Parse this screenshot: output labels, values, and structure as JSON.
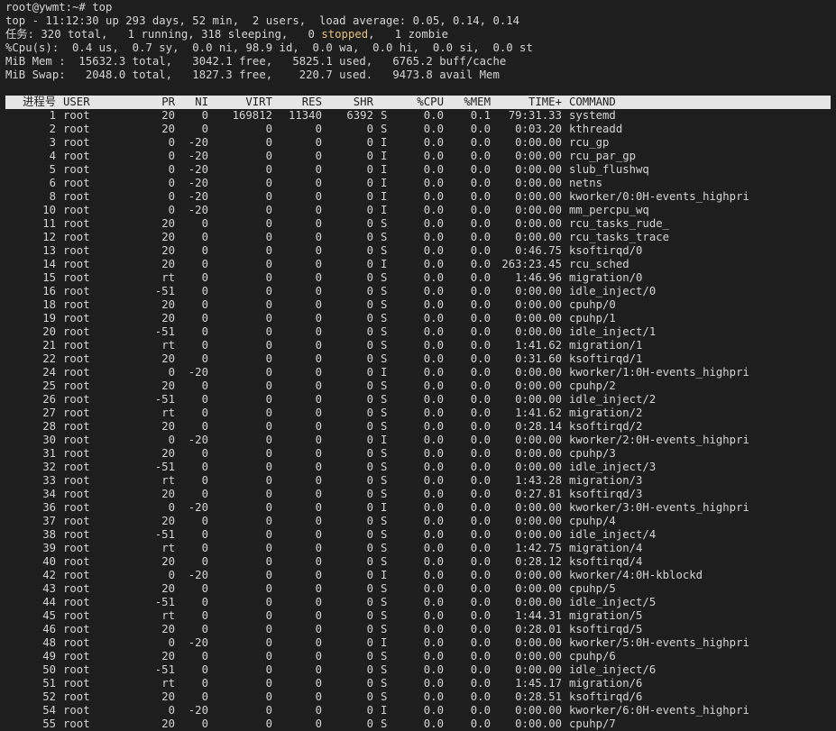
{
  "prompt_line": "root@ywmt:~# top",
  "summary": {
    "uptime_line": "top - 11:12:30 up 293 days, 52 min,  2 users,  load average: 0.05, 0.14, 0.14",
    "tasks_before": "任务: 320 total,   1 running, 318 sleeping,   0 ",
    "tasks_stopped": "stopped",
    "tasks_after": ",   1 zombie",
    "cpu_line": "%Cpu(s):  0.4 us,  0.7 sy,  0.0 ni, 98.9 id,  0.0 wa,  0.0 hi,  0.0 si,  0.0 st",
    "mem_line": "MiB Mem :  15632.3 total,   3042.1 free,   5825.1 used,   6765.2 buff/cache",
    "swap_line": "MiB Swap:   2048.0 total,   1827.3 free,    220.7 used.   9473.8 avail Mem"
  },
  "columns": [
    "进程号",
    "USER",
    "PR",
    "NI",
    "VIRT",
    "RES",
    "SHR",
    "",
    "%CPU",
    "%MEM",
    "TIME+",
    "COMMAND"
  ],
  "processes": [
    [
      "1",
      "root",
      "20",
      "0",
      "169812",
      "11340",
      "6392",
      "S",
      "0.0",
      "0.1",
      "79:31.33",
      "systemd"
    ],
    [
      "2",
      "root",
      "20",
      "0",
      "0",
      "0",
      "0",
      "S",
      "0.0",
      "0.0",
      "0:03.20",
      "kthreadd"
    ],
    [
      "3",
      "root",
      "0",
      "-20",
      "0",
      "0",
      "0",
      "I",
      "0.0",
      "0.0",
      "0:00.00",
      "rcu_gp"
    ],
    [
      "4",
      "root",
      "0",
      "-20",
      "0",
      "0",
      "0",
      "I",
      "0.0",
      "0.0",
      "0:00.00",
      "rcu_par_gp"
    ],
    [
      "5",
      "root",
      "0",
      "-20",
      "0",
      "0",
      "0",
      "I",
      "0.0",
      "0.0",
      "0:00.00",
      "slub_flushwq"
    ],
    [
      "6",
      "root",
      "0",
      "-20",
      "0",
      "0",
      "0",
      "I",
      "0.0",
      "0.0",
      "0:00.00",
      "netns"
    ],
    [
      "8",
      "root",
      "0",
      "-20",
      "0",
      "0",
      "0",
      "I",
      "0.0",
      "0.0",
      "0:00.00",
      "kworker/0:0H-events_highpri"
    ],
    [
      "10",
      "root",
      "0",
      "-20",
      "0",
      "0",
      "0",
      "I",
      "0.0",
      "0.0",
      "0:00.00",
      "mm_percpu_wq"
    ],
    [
      "11",
      "root",
      "20",
      "0",
      "0",
      "0",
      "0",
      "S",
      "0.0",
      "0.0",
      "0:00.00",
      "rcu_tasks_rude_"
    ],
    [
      "12",
      "root",
      "20",
      "0",
      "0",
      "0",
      "0",
      "S",
      "0.0",
      "0.0",
      "0:00.00",
      "rcu_tasks_trace"
    ],
    [
      "13",
      "root",
      "20",
      "0",
      "0",
      "0",
      "0",
      "S",
      "0.0",
      "0.0",
      "0:46.75",
      "ksoftirqd/0"
    ],
    [
      "14",
      "root",
      "20",
      "0",
      "0",
      "0",
      "0",
      "I",
      "0.0",
      "0.0",
      "263:23.45",
      "rcu_sched"
    ],
    [
      "15",
      "root",
      "rt",
      "0",
      "0",
      "0",
      "0",
      "S",
      "0.0",
      "0.0",
      "1:46.96",
      "migration/0"
    ],
    [
      "16",
      "root",
      "-51",
      "0",
      "0",
      "0",
      "0",
      "S",
      "0.0",
      "0.0",
      "0:00.00",
      "idle_inject/0"
    ],
    [
      "18",
      "root",
      "20",
      "0",
      "0",
      "0",
      "0",
      "S",
      "0.0",
      "0.0",
      "0:00.00",
      "cpuhp/0"
    ],
    [
      "19",
      "root",
      "20",
      "0",
      "0",
      "0",
      "0",
      "S",
      "0.0",
      "0.0",
      "0:00.00",
      "cpuhp/1"
    ],
    [
      "20",
      "root",
      "-51",
      "0",
      "0",
      "0",
      "0",
      "S",
      "0.0",
      "0.0",
      "0:00.00",
      "idle_inject/1"
    ],
    [
      "21",
      "root",
      "rt",
      "0",
      "0",
      "0",
      "0",
      "S",
      "0.0",
      "0.0",
      "1:41.62",
      "migration/1"
    ],
    [
      "22",
      "root",
      "20",
      "0",
      "0",
      "0",
      "0",
      "S",
      "0.0",
      "0.0",
      "0:31.60",
      "ksoftirqd/1"
    ],
    [
      "24",
      "root",
      "0",
      "-20",
      "0",
      "0",
      "0",
      "I",
      "0.0",
      "0.0",
      "0:00.00",
      "kworker/1:0H-events_highpri"
    ],
    [
      "25",
      "root",
      "20",
      "0",
      "0",
      "0",
      "0",
      "S",
      "0.0",
      "0.0",
      "0:00.00",
      "cpuhp/2"
    ],
    [
      "26",
      "root",
      "-51",
      "0",
      "0",
      "0",
      "0",
      "S",
      "0.0",
      "0.0",
      "0:00.00",
      "idle_inject/2"
    ],
    [
      "27",
      "root",
      "rt",
      "0",
      "0",
      "0",
      "0",
      "S",
      "0.0",
      "0.0",
      "1:41.62",
      "migration/2"
    ],
    [
      "28",
      "root",
      "20",
      "0",
      "0",
      "0",
      "0",
      "S",
      "0.0",
      "0.0",
      "0:28.14",
      "ksoftirqd/2"
    ],
    [
      "30",
      "root",
      "0",
      "-20",
      "0",
      "0",
      "0",
      "I",
      "0.0",
      "0.0",
      "0:00.00",
      "kworker/2:0H-events_highpri"
    ],
    [
      "31",
      "root",
      "20",
      "0",
      "0",
      "0",
      "0",
      "S",
      "0.0",
      "0.0",
      "0:00.00",
      "cpuhp/3"
    ],
    [
      "32",
      "root",
      "-51",
      "0",
      "0",
      "0",
      "0",
      "S",
      "0.0",
      "0.0",
      "0:00.00",
      "idle_inject/3"
    ],
    [
      "33",
      "root",
      "rt",
      "0",
      "0",
      "0",
      "0",
      "S",
      "0.0",
      "0.0",
      "1:43.28",
      "migration/3"
    ],
    [
      "34",
      "root",
      "20",
      "0",
      "0",
      "0",
      "0",
      "S",
      "0.0",
      "0.0",
      "0:27.81",
      "ksoftirqd/3"
    ],
    [
      "36",
      "root",
      "0",
      "-20",
      "0",
      "0",
      "0",
      "I",
      "0.0",
      "0.0",
      "0:00.00",
      "kworker/3:0H-events_highpri"
    ],
    [
      "37",
      "root",
      "20",
      "0",
      "0",
      "0",
      "0",
      "S",
      "0.0",
      "0.0",
      "0:00.00",
      "cpuhp/4"
    ],
    [
      "38",
      "root",
      "-51",
      "0",
      "0",
      "0",
      "0",
      "S",
      "0.0",
      "0.0",
      "0:00.00",
      "idle_inject/4"
    ],
    [
      "39",
      "root",
      "rt",
      "0",
      "0",
      "0",
      "0",
      "S",
      "0.0",
      "0.0",
      "1:42.75",
      "migration/4"
    ],
    [
      "40",
      "root",
      "20",
      "0",
      "0",
      "0",
      "0",
      "S",
      "0.0",
      "0.0",
      "0:28.12",
      "ksoftirqd/4"
    ],
    [
      "42",
      "root",
      "0",
      "-20",
      "0",
      "0",
      "0",
      "I",
      "0.0",
      "0.0",
      "0:00.00",
      "kworker/4:0H-kblockd"
    ],
    [
      "43",
      "root",
      "20",
      "0",
      "0",
      "0",
      "0",
      "S",
      "0.0",
      "0.0",
      "0:00.00",
      "cpuhp/5"
    ],
    [
      "44",
      "root",
      "-51",
      "0",
      "0",
      "0",
      "0",
      "S",
      "0.0",
      "0.0",
      "0:00.00",
      "idle_inject/5"
    ],
    [
      "45",
      "root",
      "rt",
      "0",
      "0",
      "0",
      "0",
      "S",
      "0.0",
      "0.0",
      "1:44.31",
      "migration/5"
    ],
    [
      "46",
      "root",
      "20",
      "0",
      "0",
      "0",
      "0",
      "S",
      "0.0",
      "0.0",
      "0:28.01",
      "ksoftirqd/5"
    ],
    [
      "48",
      "root",
      "0",
      "-20",
      "0",
      "0",
      "0",
      "I",
      "0.0",
      "0.0",
      "0:00.00",
      "kworker/5:0H-events_highpri"
    ],
    [
      "49",
      "root",
      "20",
      "0",
      "0",
      "0",
      "0",
      "S",
      "0.0",
      "0.0",
      "0:00.00",
      "cpuhp/6"
    ],
    [
      "50",
      "root",
      "-51",
      "0",
      "0",
      "0",
      "0",
      "S",
      "0.0",
      "0.0",
      "0:00.00",
      "idle_inject/6"
    ],
    [
      "51",
      "root",
      "rt",
      "0",
      "0",
      "0",
      "0",
      "S",
      "0.0",
      "0.0",
      "1:45.17",
      "migration/6"
    ],
    [
      "52",
      "root",
      "20",
      "0",
      "0",
      "0",
      "0",
      "S",
      "0.0",
      "0.0",
      "0:28.51",
      "ksoftirqd/6"
    ],
    [
      "54",
      "root",
      "0",
      "-20",
      "0",
      "0",
      "0",
      "I",
      "0.0",
      "0.0",
      "0:00.00",
      "kworker/6:0H-events_highpri"
    ],
    [
      "55",
      "root",
      "20",
      "0",
      "0",
      "0",
      "0",
      "S",
      "0.0",
      "0.0",
      "0:00.00",
      "cpuhp/7"
    ]
  ],
  "colors": {
    "background": "#1e1e1e",
    "foreground": "#d4d4d4",
    "header_bg": "#e6e6e6",
    "stopped": "#e5c07b"
  }
}
